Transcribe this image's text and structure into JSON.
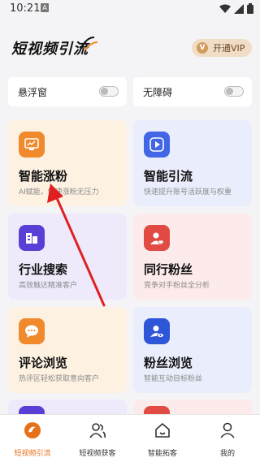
{
  "status": {
    "time": "10:21",
    "indicator": "A"
  },
  "header": {
    "title": "短视频引流",
    "vip_label": "开通VIP",
    "vip_icon": "V"
  },
  "toggles": [
    {
      "label": "悬浮窗",
      "on": false
    },
    {
      "label": "无障碍",
      "on": false
    }
  ],
  "cards": [
    {
      "title": "智能涨粉",
      "subtitle": "AI赋能，快速涨粉无压力",
      "icon": "monitor-chart-icon",
      "accent": "#f08a2c"
    },
    {
      "title": "智能引流",
      "subtitle": "快速提升账号活跃度与权重",
      "icon": "play-arrow-icon",
      "accent": "#4266e6"
    },
    {
      "title": "行业搜索",
      "subtitle": "高效触达精准客户",
      "icon": "buildings-icon",
      "accent": "#5a3fd6"
    },
    {
      "title": "同行粉丝",
      "subtitle": "竞争对手粉丝全分析",
      "icon": "person-card-icon",
      "accent": "#e14b44"
    },
    {
      "title": "评论浏览",
      "subtitle": "热评区轻松获取意向客户",
      "icon": "chat-bubble-icon",
      "accent": "#f08a2c"
    },
    {
      "title": "粉丝浏览",
      "subtitle": "智能互动目标粉丝",
      "icon": "person-eye-icon",
      "accent": "#2f55d8"
    }
  ],
  "nav": [
    {
      "label": "短视频引流",
      "active": true,
      "icon": "vortex-icon"
    },
    {
      "label": "短视频获客",
      "active": false,
      "icon": "users-icon"
    },
    {
      "label": "智能拓客",
      "active": false,
      "icon": "home-icon"
    },
    {
      "label": "我的",
      "active": false,
      "icon": "user-icon"
    }
  ],
  "colors": {
    "active": "#e7701a",
    "annotation": "#e02020"
  }
}
